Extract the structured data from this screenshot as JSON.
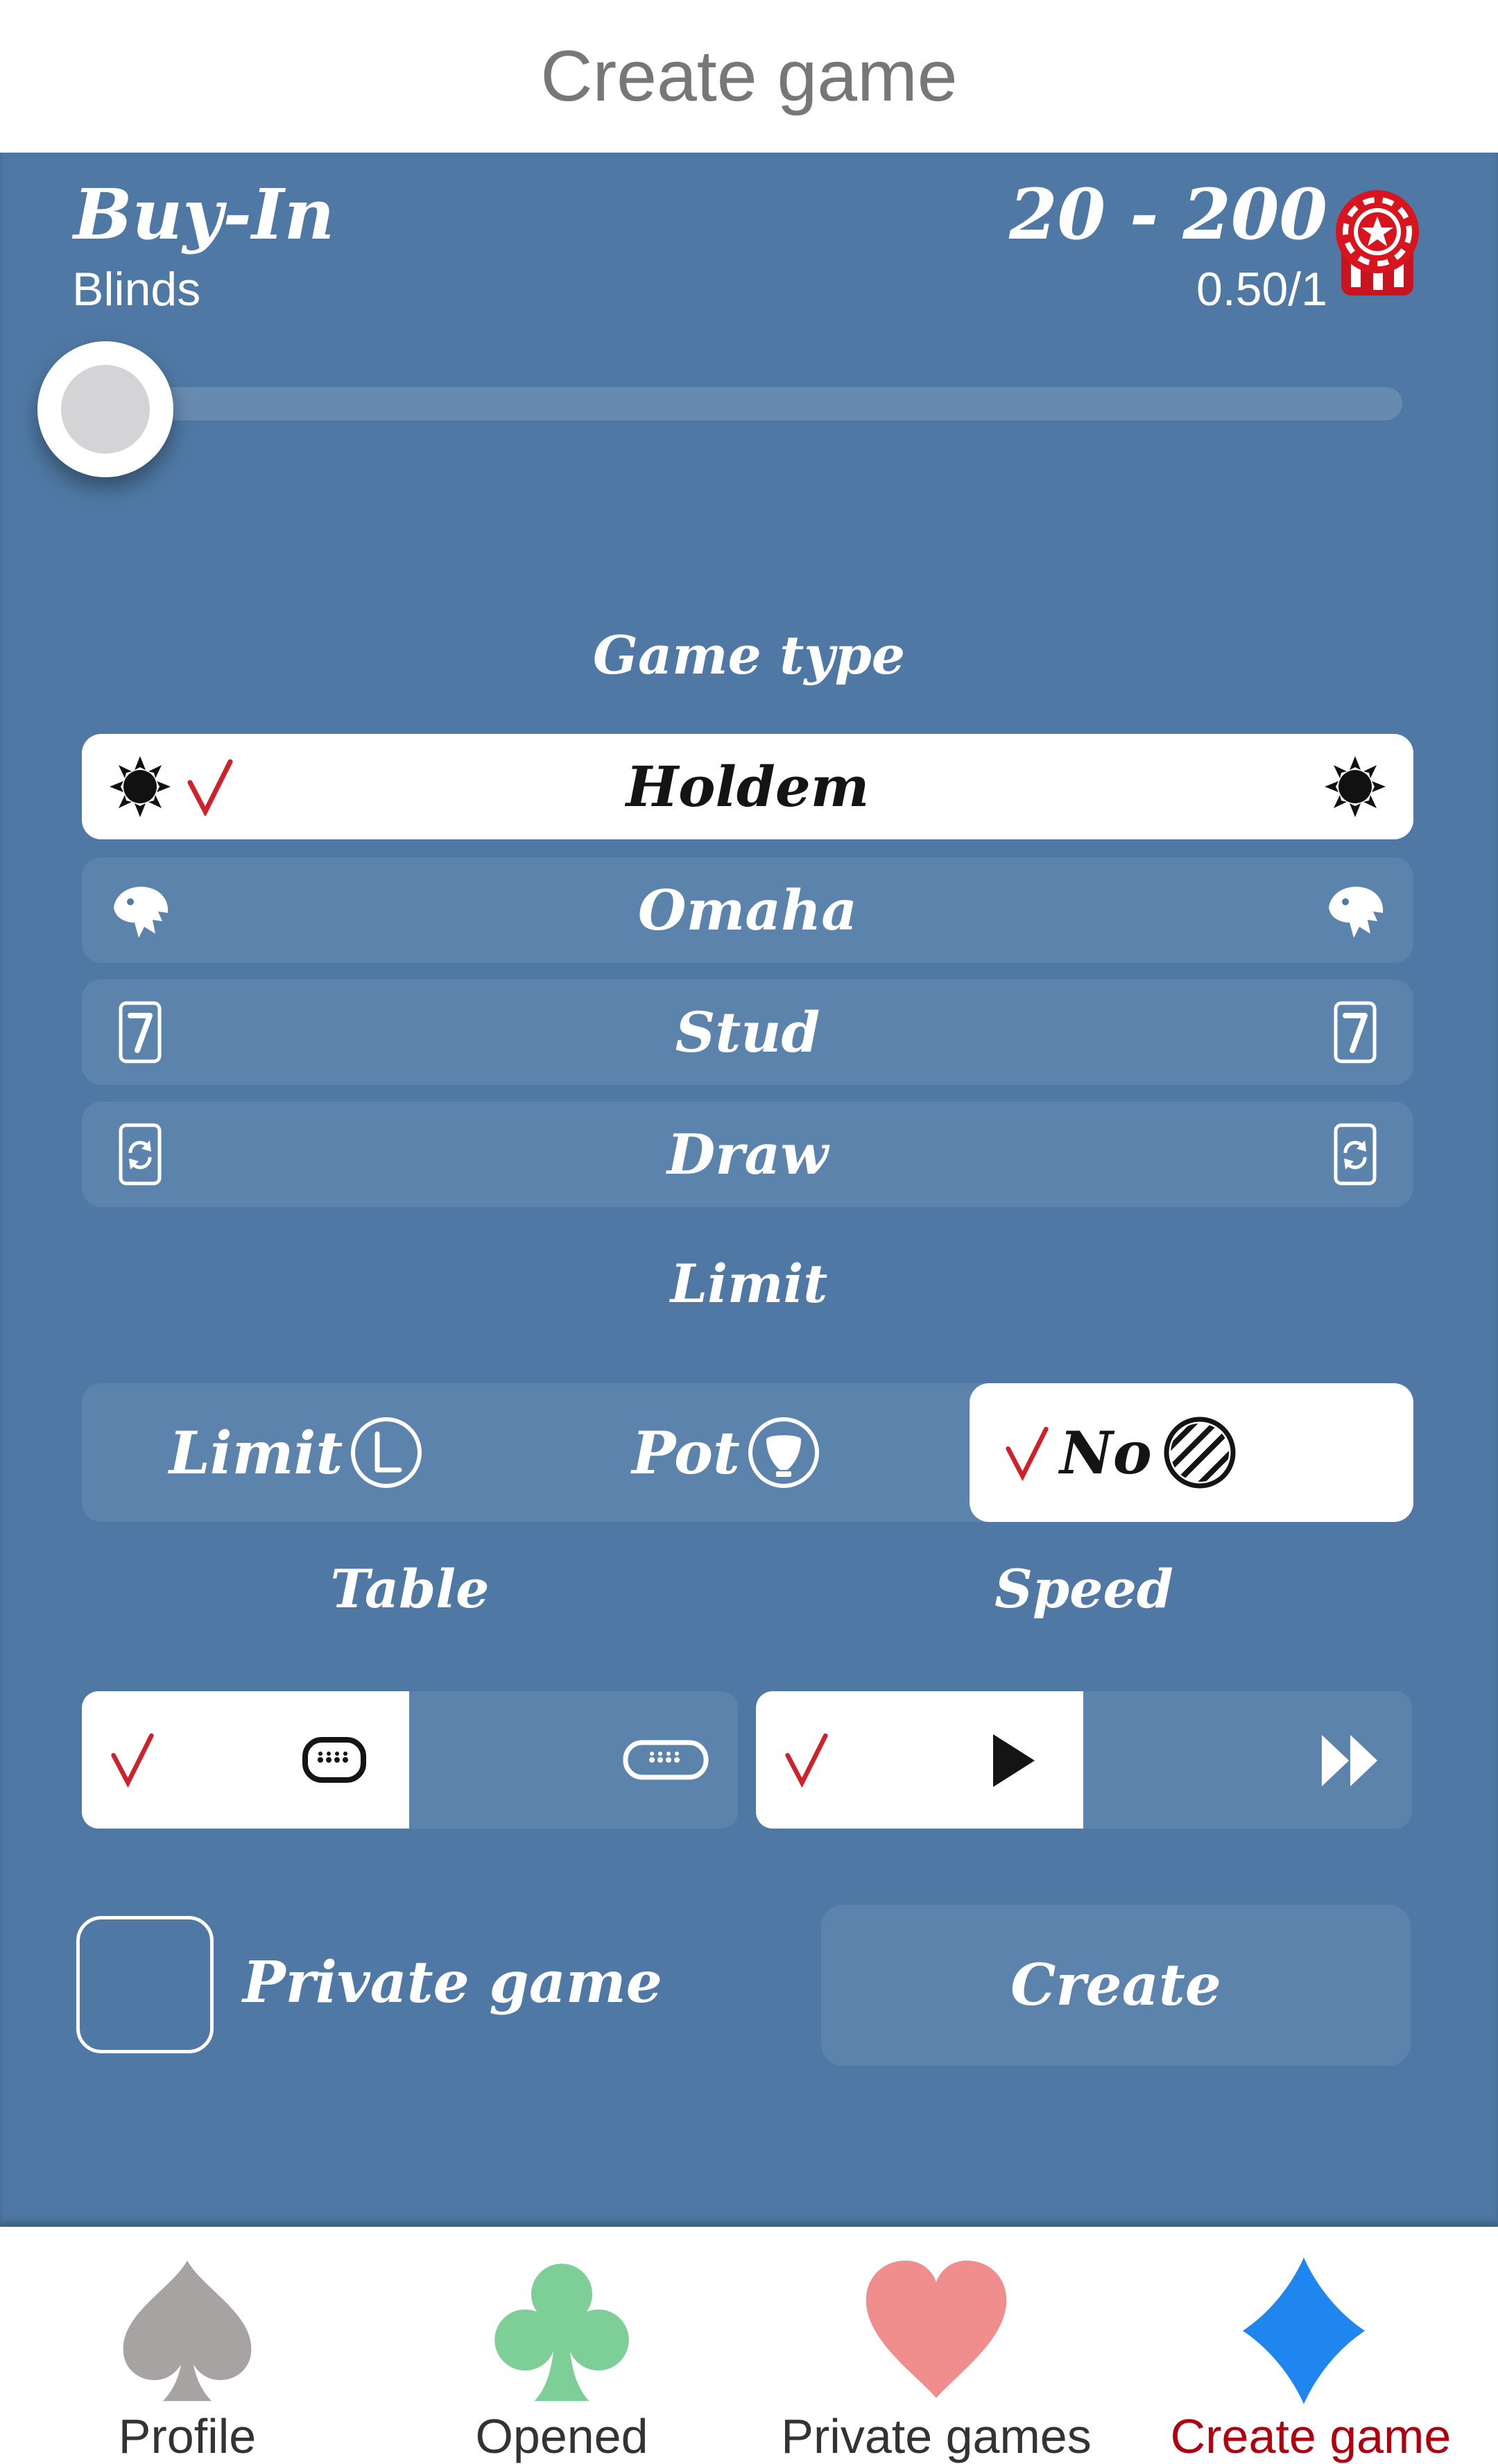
{
  "header": {
    "title": "Create game"
  },
  "buyin": {
    "label": "Buy-In",
    "value": "20 - 200",
    "blinds_label": "Blinds",
    "blinds_value": "0.50/1",
    "slider_fraction": 0.0
  },
  "game_type": {
    "title": "Game type",
    "options": [
      {
        "label": "Holdem",
        "icon": "crown-icon",
        "selected": true
      },
      {
        "label": "Omaha",
        "icon": "eagle-head-icon",
        "selected": false
      },
      {
        "label": "Stud",
        "icon": "card-seven-icon",
        "selected": false
      },
      {
        "label": "Draw",
        "icon": "card-refresh-icon",
        "selected": false
      }
    ]
  },
  "limit": {
    "title": "Limit",
    "options": [
      {
        "label": "Limit",
        "icon": "letter-l-circle-icon",
        "selected": false
      },
      {
        "label": "Pot",
        "icon": "pot-circle-icon",
        "selected": false
      },
      {
        "label": "No",
        "icon": "striped-circle-icon",
        "selected": true
      }
    ]
  },
  "table": {
    "title": "Table",
    "options": [
      {
        "icon": "short-table-icon",
        "selected": true
      },
      {
        "icon": "long-table-icon",
        "selected": false
      }
    ]
  },
  "speed": {
    "title": "Speed",
    "options": [
      {
        "icon": "play-icon",
        "selected": true
      },
      {
        "icon": "fast-forward-icon",
        "selected": false
      }
    ]
  },
  "private_game": {
    "label": "Private game",
    "checked": false
  },
  "create_button": {
    "label": "Create"
  },
  "tabs": [
    {
      "label": "Profile",
      "icon": "spade-icon",
      "color": "#a8a3a3",
      "active": false
    },
    {
      "label": "Opened",
      "icon": "club-icon",
      "color": "#7ecf97",
      "active": false
    },
    {
      "label": "Private games",
      "icon": "heart-icon",
      "color": "#f08d8d",
      "active": false
    },
    {
      "label": "Create game",
      "icon": "diamond-icon",
      "color": "#1f86f0",
      "active": true
    }
  ],
  "colors": {
    "panel": "#4f79a4",
    "check": "#d0202a",
    "active_tab_text": "#b00010"
  }
}
